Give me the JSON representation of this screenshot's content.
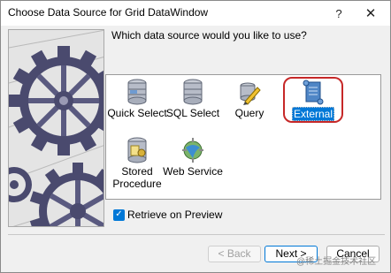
{
  "window": {
    "title": "Choose Data Source for Grid DataWindow",
    "help_label": "?",
    "close_label": "✕"
  },
  "prompt": {
    "question": "Which data source would you like to use?"
  },
  "choices": [
    {
      "label": "Quick Select",
      "icon": "database-icon",
      "selected": false
    },
    {
      "label": "SQL Select",
      "icon": "database-icon",
      "selected": false
    },
    {
      "label": "Query",
      "icon": "query-icon",
      "selected": false
    },
    {
      "label": "External",
      "icon": "scroll-icon",
      "selected": true
    },
    {
      "label": "Stored Procedure",
      "icon": "stored-procedure-icon",
      "selected": false
    },
    {
      "label": "Web Service",
      "icon": "web-service-icon",
      "selected": false
    }
  ],
  "retrieve": {
    "label": "Retrieve on Preview",
    "checked": true
  },
  "buttons": {
    "back": "< Back",
    "next": "Next >",
    "cancel": "Cancel"
  },
  "watermark": "@稀土掘金技术社区",
  "colors": {
    "accent": "#0078d7",
    "ring": "#c62828"
  }
}
